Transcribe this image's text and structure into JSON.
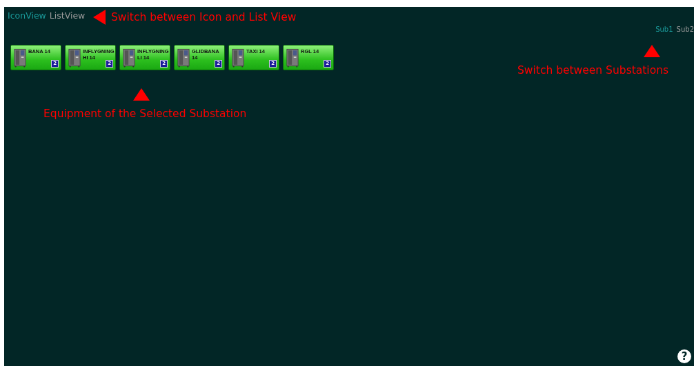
{
  "view_tabs": [
    {
      "label": "IconView",
      "selected": true
    },
    {
      "label": "ListView",
      "selected": false
    }
  ],
  "substation_tabs": [
    {
      "label": "Sub1",
      "selected": true
    },
    {
      "label": "Sub2",
      "selected": false
    }
  ],
  "equipment": [
    {
      "name": "BANA 14",
      "count": "2"
    },
    {
      "name": "INFLYGNING HI 14",
      "count": "2"
    },
    {
      "name": "INFLYGNING LI 14",
      "count": "2"
    },
    {
      "name": "GLIDBANA 14",
      "count": "2"
    },
    {
      "name": "TAXI 14",
      "count": "2"
    },
    {
      "name": "RGL 14",
      "count": "2"
    }
  ],
  "annotations": [
    {
      "text": "Switch between Icon and List View",
      "kind": "left"
    },
    {
      "text": "Switch between Substations",
      "kind": "up"
    },
    {
      "text": "Equipment of the Selected Substation",
      "kind": "up"
    }
  ],
  "help": {
    "label": "?"
  }
}
